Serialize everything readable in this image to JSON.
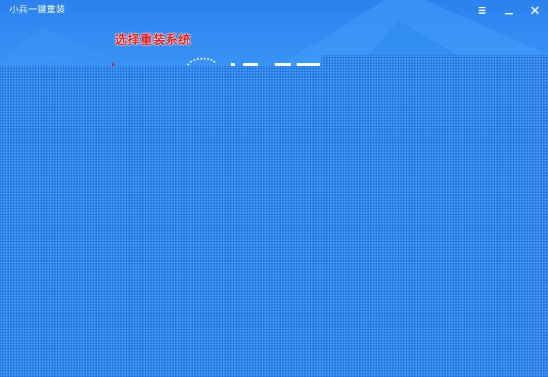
{
  "window": {
    "title": "小兵一键重装"
  },
  "controls": {
    "menu_icon": "menu-icon",
    "minimize_icon": "minimize-icon",
    "close_icon": "close-icon"
  },
  "main": {
    "heading": "选择重装系统"
  },
  "colors": {
    "background": "#2f86ef",
    "heading_text": "#e4201d",
    "title_text": "#ffffff"
  }
}
